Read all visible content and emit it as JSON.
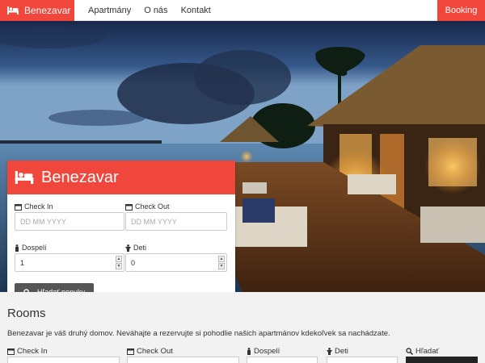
{
  "nav": {
    "brand": "Benezavar",
    "links": [
      "Apartmány",
      "O nás",
      "Kontakt"
    ],
    "booking": "Booking"
  },
  "card": {
    "title": "Benezavar",
    "checkin_label": "Check In",
    "checkin_placeholder": "DD MM YYYY",
    "checkout_label": "Check Out",
    "checkout_placeholder": "DD MM YYYY",
    "adults_label": "Dospelí",
    "adults_value": "1",
    "children_label": "Deti",
    "children_value": "0",
    "search_label": "Hľadať ponuky"
  },
  "rooms": {
    "title": "Rooms",
    "intro": "Benezavar je váš druhý domov. Neváhajte a rezervujte si pohodlie našich apartmánov kdekoľvek sa nachádzate.",
    "filters": {
      "checkin": "Check In",
      "checkout": "Check Out",
      "adults": "Dospelí",
      "children": "Deti",
      "search": "Hľadať"
    }
  },
  "icons": {
    "bed": "bed-icon",
    "calendar": "calendar-icon",
    "person": "person-icon",
    "child": "child-icon",
    "search": "search-icon"
  },
  "colors": {
    "accent": "#f0463c",
    "button": "#555555"
  }
}
